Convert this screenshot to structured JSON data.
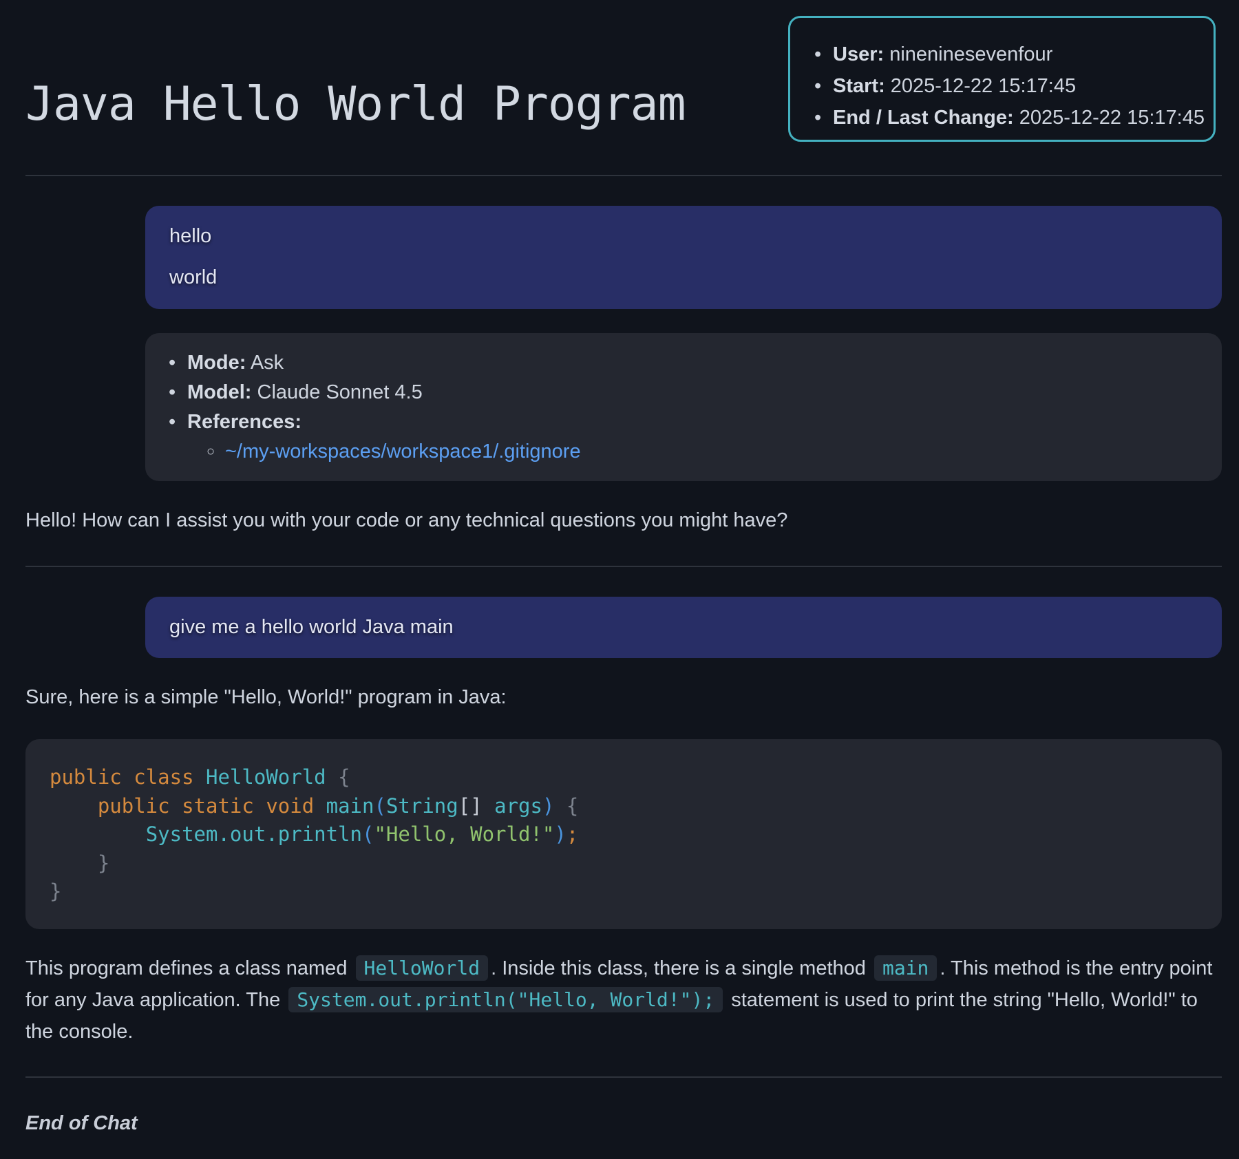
{
  "page": {
    "title": "Java Hello World Program"
  },
  "meta": {
    "user_label": "User:",
    "user": "nineninesevenfour",
    "start_label": "Start:",
    "start": "2025-12-22 15:17:45",
    "end_label": "End / Last Change:",
    "end": "2025-12-22 15:17:45"
  },
  "chat": [
    {
      "user_lines": [
        "hello",
        "world"
      ],
      "info": {
        "mode_label": "Mode:",
        "mode": "Ask",
        "model_label": "Model:",
        "model": "Claude Sonnet 4.5",
        "references_label": "References:",
        "references": [
          "~/my-workspaces/workspace1/.gitignore"
        ]
      },
      "reply": "Hello! How can I assist you with your code or any technical questions you might have?"
    },
    {
      "user_lines": [
        "give me a hello world Java main"
      ],
      "reply_intro": "Sure, here is a simple \"Hello, World!\" program in Java:",
      "code": {
        "t_public1": "public",
        "t_class": "class",
        "t_classname": "HelloWorld",
        "t_open1": "{",
        "t_public2": "public",
        "t_static": "static",
        "t_void": "void",
        "t_main": "main",
        "t_lp": "(",
        "t_string": "String",
        "t_brackets": "[]",
        "t_args": "args",
        "t_rp": ")",
        "t_open2": "{",
        "t_println": "System.out.println",
        "t_lp2": "(",
        "t_str": "\"Hello, World!\"",
        "t_rp2": ")",
        "t_semi": ";",
        "t_close2": "}",
        "t_close1": "}"
      },
      "explanation": {
        "part1": "This program defines a class named ",
        "code1": "HelloWorld",
        "part2": ". Inside this class, there is a single method ",
        "code2": "main",
        "part3": ". This method is the entry point for any Java application. The ",
        "code3": "System.out.println(\"Hello, World!\");",
        "part4": " statement is used to print the string \"Hello, World!\" to the console."
      }
    }
  ],
  "footer": {
    "end_text": "End of Chat"
  },
  "colors": {
    "background": "#10141c",
    "user_bubble": "#282e66",
    "card": "#242730",
    "accent_border": "#44b1c0",
    "link": "#5c9ff2",
    "keyword": "#d58a3e",
    "identifier": "#4dbac5",
    "string": "#91c46e"
  }
}
